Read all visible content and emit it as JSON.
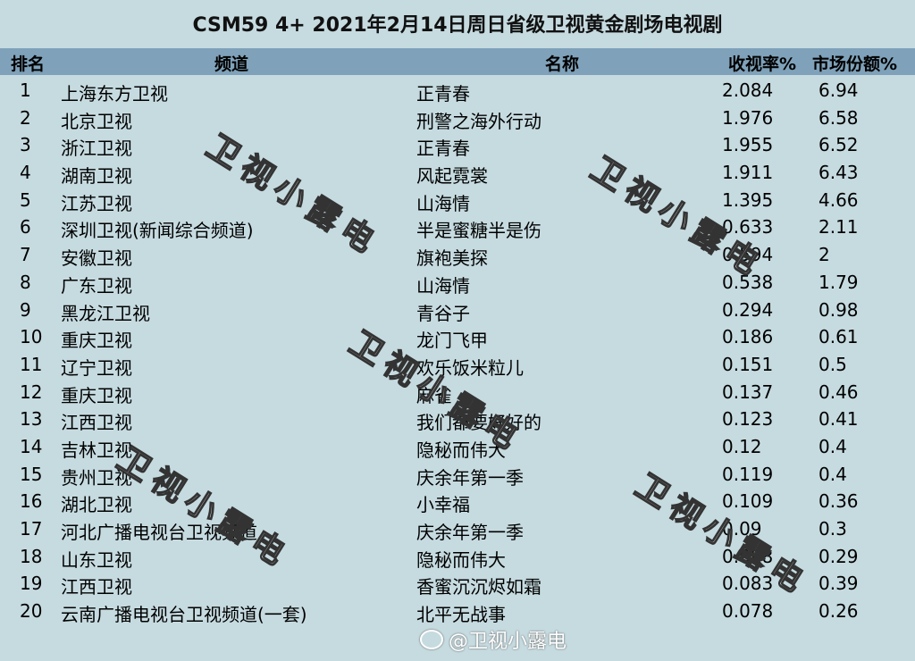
{
  "title": "CSM59 4+ 2021年2月14日周日省级卫视黄金剧场电视剧",
  "headers": {
    "rank": "排名",
    "channel": "频道",
    "name": "名称",
    "rating": "收视率%",
    "share": "市场份额%"
  },
  "rows": [
    {
      "rank": "1",
      "channel": "上海东方卫视",
      "name": "正青春",
      "rating": "2.084",
      "share": "6.94"
    },
    {
      "rank": "2",
      "channel": "北京卫视",
      "name": "刑警之海外行动",
      "rating": "1.976",
      "share": "6.58"
    },
    {
      "rank": "3",
      "channel": "浙江卫视",
      "name": "正青春",
      "rating": "1.955",
      "share": "6.52"
    },
    {
      "rank": "4",
      "channel": "湖南卫视",
      "name": "风起霓裳",
      "rating": "1.911",
      "share": "6.43"
    },
    {
      "rank": "5",
      "channel": "江苏卫视",
      "name": "山海情",
      "rating": "1.395",
      "share": "4.66"
    },
    {
      "rank": "6",
      "channel": "深圳卫视(新闻综合频道)",
      "name": "半是蜜糖半是伤",
      "rating": "0.633",
      "share": "2.11"
    },
    {
      "rank": "7",
      "channel": "安徽卫视",
      "name": "旗袍美探",
      "rating": "0.594",
      "share": "2"
    },
    {
      "rank": "8",
      "channel": "广东卫视",
      "name": "山海情",
      "rating": "0.538",
      "share": "1.79"
    },
    {
      "rank": "9",
      "channel": "黑龙江卫视",
      "name": "青谷子",
      "rating": "0.294",
      "share": "0.98"
    },
    {
      "rank": "10",
      "channel": "重庆卫视",
      "name": "龙门飞甲",
      "rating": "0.186",
      "share": "0.61"
    },
    {
      "rank": "11",
      "channel": "辽宁卫视",
      "name": "欢乐饭米粒儿",
      "rating": "0.151",
      "share": "0.5"
    },
    {
      "rank": "12",
      "channel": "重庆卫视",
      "name": "麻雀",
      "rating": "0.137",
      "share": "0.46"
    },
    {
      "rank": "13",
      "channel": "江西卫视",
      "name": "我们都要好好的",
      "rating": "0.123",
      "share": "0.41"
    },
    {
      "rank": "14",
      "channel": "吉林卫视",
      "name": "隐秘而伟大",
      "rating": "0.12",
      "share": "0.4"
    },
    {
      "rank": "15",
      "channel": "贵州卫视",
      "name": "庆余年第一季",
      "rating": "0.119",
      "share": "0.4"
    },
    {
      "rank": "16",
      "channel": "湖北卫视",
      "name": "小幸福",
      "rating": "0.109",
      "share": "0.36"
    },
    {
      "rank": "17",
      "channel": "河北广播电视台卫视频道",
      "name": "庆余年第一季",
      "rating": "0.09",
      "share": "0.3"
    },
    {
      "rank": "18",
      "channel": "山东卫视",
      "name": "隐秘而伟大",
      "rating": "0.088",
      "share": "0.29"
    },
    {
      "rank": "19",
      "channel": "江西卫视",
      "name": "香蜜沉沉烬如霜",
      "rating": "0.083",
      "share": "0.39"
    },
    {
      "rank": "20",
      "channel": "云南广播电视台卫视频道(一套)",
      "name": "北平无战事",
      "rating": "0.078",
      "share": "0.26"
    }
  ],
  "watermark": "卫视小露电",
  "weibo_handle": "@卫视小露电"
}
